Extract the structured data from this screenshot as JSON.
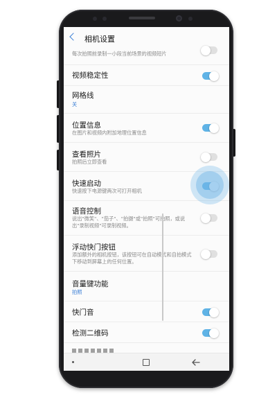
{
  "app_bar": {
    "title": "相机设置"
  },
  "settings": [
    {
      "title": "",
      "subtitle": "每次拍照前录制一小段当前场景的视频短片",
      "toggle": true,
      "on": false
    },
    {
      "title": "视频稳定性",
      "subtitle": "",
      "toggle": true,
      "on": true
    },
    {
      "title": "网格线",
      "value": "关",
      "toggle": false
    },
    {
      "title": "位置信息",
      "subtitle": "在图片和视频内附加地理位置信息",
      "toggle": true,
      "on": true
    },
    {
      "title": "查看照片",
      "subtitle": "拍照后立即查看",
      "toggle": true,
      "on": false
    },
    {
      "title": "快速启动",
      "subtitle": "快速按下电源键两次可打开相机",
      "toggle": true,
      "on": true
    },
    {
      "title": "语音控制",
      "subtitle": "说出\"微笑\"、\"茄子\"、\"拍摄\"或\"拍照\"可拍照，或说出\"录制视频\"可录制视频。",
      "toggle": true,
      "on": false
    },
    {
      "title": "浮动快门按钮",
      "subtitle": "添加额外的相机按钮，该按钮可在自动模式和自拍模式下移动到屏幕上的任何位置。",
      "toggle": true,
      "on": false
    },
    {
      "title": "音量键功能",
      "value": "拍照",
      "toggle": false
    },
    {
      "title": "快门音",
      "subtitle": "",
      "toggle": true,
      "on": true
    },
    {
      "title": "检测二维码",
      "subtitle": "",
      "toggle": true,
      "on": true
    }
  ],
  "colors": {
    "accent": "#3b7fd6",
    "switch_on": "#5fb3e6",
    "switch_off": "#e0e0e0"
  },
  "icons": {
    "back": "chevron-left-icon",
    "nav_recent": "recent-apps-icon",
    "nav_back": "back-arrow-icon"
  }
}
